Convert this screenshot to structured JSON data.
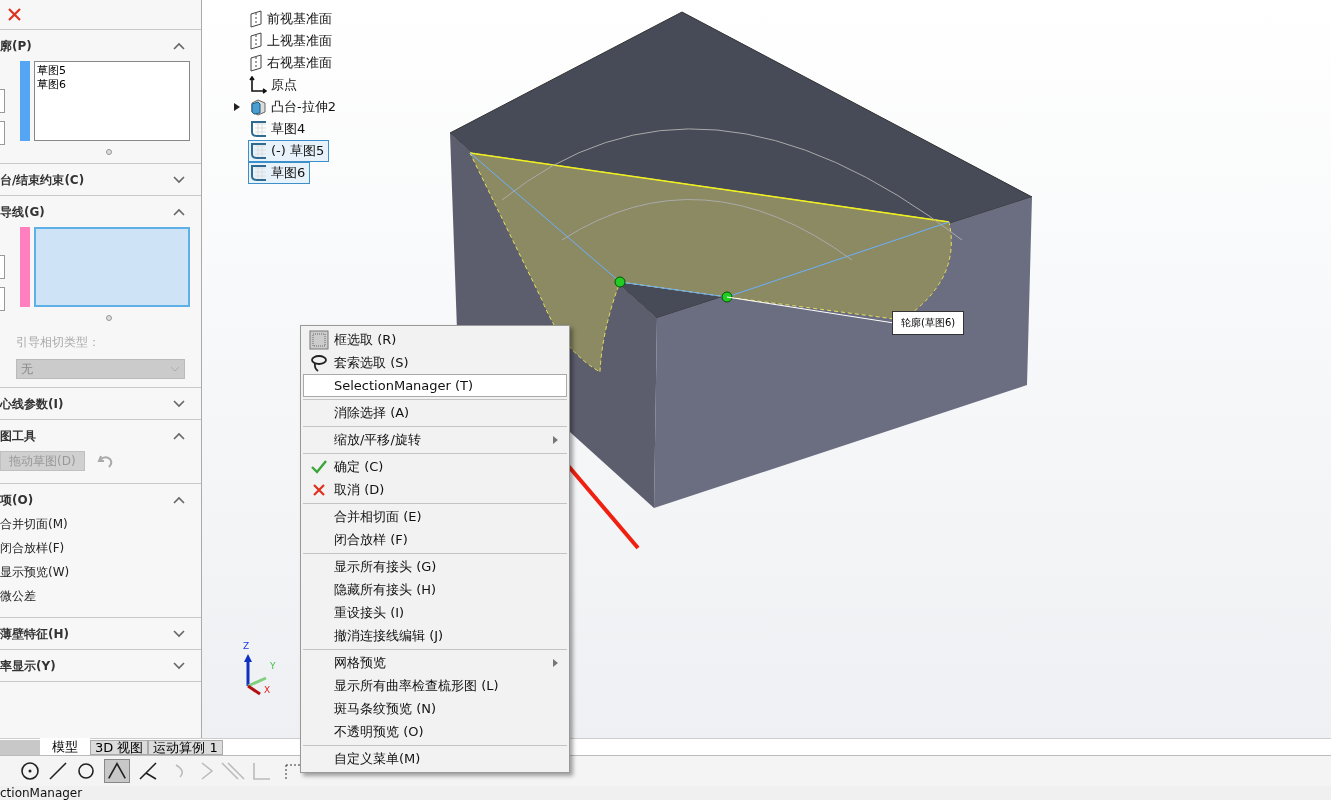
{
  "panel": {
    "sections": [
      {
        "title": "廓(P)",
        "expanded": true,
        "kind": "list",
        "color": "#55a5f5",
        "items": [
          "草图5",
          "草图6"
        ],
        "selected": false
      },
      {
        "title": "台/结束约束(C)",
        "expanded": false
      },
      {
        "title": "导线(G)",
        "expanded": true,
        "kind": "list",
        "color": "#ff7fbf",
        "selected": true,
        "field_label": "引导相切类型：",
        "dropdown": "无"
      },
      {
        "title": "心线参数(I)",
        "expanded": false
      },
      {
        "title": "图工具",
        "expanded": true,
        "kind": "tools",
        "button": "拖动草图(D)"
      },
      {
        "title": "项(O)",
        "expanded": true,
        "kind": "options",
        "options": [
          "合并切面(M)",
          "闭合放样(F)",
          "显示预览(W)",
          "微公差"
        ]
      },
      {
        "title": "薄壁特征(H)",
        "expanded": false
      },
      {
        "title": "率显示(Y)",
        "expanded": false
      }
    ]
  },
  "tree": [
    {
      "label": "前视基准面",
      "kind": "plane",
      "selected": false
    },
    {
      "label": "上视基准面",
      "kind": "plane",
      "selected": false
    },
    {
      "label": "右视基准面",
      "kind": "plane",
      "selected": false
    },
    {
      "label": "原点",
      "kind": "origin",
      "selected": false
    },
    {
      "label": "凸台-拉伸2",
      "kind": "feature",
      "selected": false
    },
    {
      "label": "草图4",
      "kind": "sketch",
      "selected": false
    },
    {
      "label": "(-) 草图5",
      "kind": "sketch",
      "selected": true
    },
    {
      "label": "草图6",
      "kind": "sketch",
      "selected": true
    }
  ],
  "callout": "轮廓(草图6)",
  "triad": {
    "z": "Z",
    "y": "Y",
    "x": "X"
  },
  "menu": [
    {
      "label": "框选取 (R)",
      "kind": "box-select",
      "selected": false,
      "separator": false,
      "submenu": false
    },
    {
      "label": "套索选取 (S)",
      "kind": "lasso",
      "selected": false,
      "separator": false,
      "submenu": false
    },
    {
      "label": "SelectionManager (T)",
      "kind": "plain",
      "selected": true,
      "separator": true,
      "submenu": false
    },
    {
      "label": "消除选择 (A)",
      "kind": "plain",
      "selected": false,
      "separator": true,
      "submenu": false
    },
    {
      "label": "缩放/平移/旋转",
      "kind": "plain",
      "selected": false,
      "separator": true,
      "submenu": true
    },
    {
      "label": "确定 (C)",
      "kind": "check",
      "selected": false,
      "separator": false,
      "submenu": false
    },
    {
      "label": "取消 (D)",
      "kind": "cross",
      "selected": false,
      "separator": true,
      "submenu": false
    },
    {
      "label": "合并相切面 (E)",
      "kind": "plain",
      "selected": false,
      "separator": false,
      "submenu": false
    },
    {
      "label": "闭合放样 (F)",
      "kind": "plain",
      "selected": false,
      "separator": true,
      "submenu": false
    },
    {
      "label": "显示所有接头 (G)",
      "kind": "plain",
      "selected": false,
      "separator": false,
      "submenu": false
    },
    {
      "label": "隐藏所有接头 (H)",
      "kind": "plain",
      "selected": false,
      "separator": false,
      "submenu": false
    },
    {
      "label": "重设接头 (I)",
      "kind": "plain",
      "selected": false,
      "separator": false,
      "submenu": false
    },
    {
      "label": "撤消连接线编辑 (J)",
      "kind": "plain",
      "selected": false,
      "separator": true,
      "submenu": false
    },
    {
      "label": "网格预览",
      "kind": "plain",
      "selected": false,
      "separator": false,
      "submenu": true
    },
    {
      "label": "显示所有曲率检查梳形图 (L)",
      "kind": "plain",
      "selected": false,
      "separator": false,
      "submenu": false
    },
    {
      "label": "斑马条纹预览 (N)",
      "kind": "plain",
      "selected": false,
      "separator": false,
      "submenu": false
    },
    {
      "label": "不透明预览 (O)",
      "kind": "plain",
      "selected": false,
      "separator": true,
      "submenu": false
    },
    {
      "label": "自定义菜单(M)",
      "kind": "plain",
      "selected": false,
      "separator": false,
      "submenu": false
    }
  ],
  "tabs": [
    {
      "label": "模型",
      "selected": true
    },
    {
      "label": "3D 视图",
      "selected": false
    },
    {
      "label": "运动算例 1",
      "selected": false
    }
  ],
  "status": "ctionManager"
}
